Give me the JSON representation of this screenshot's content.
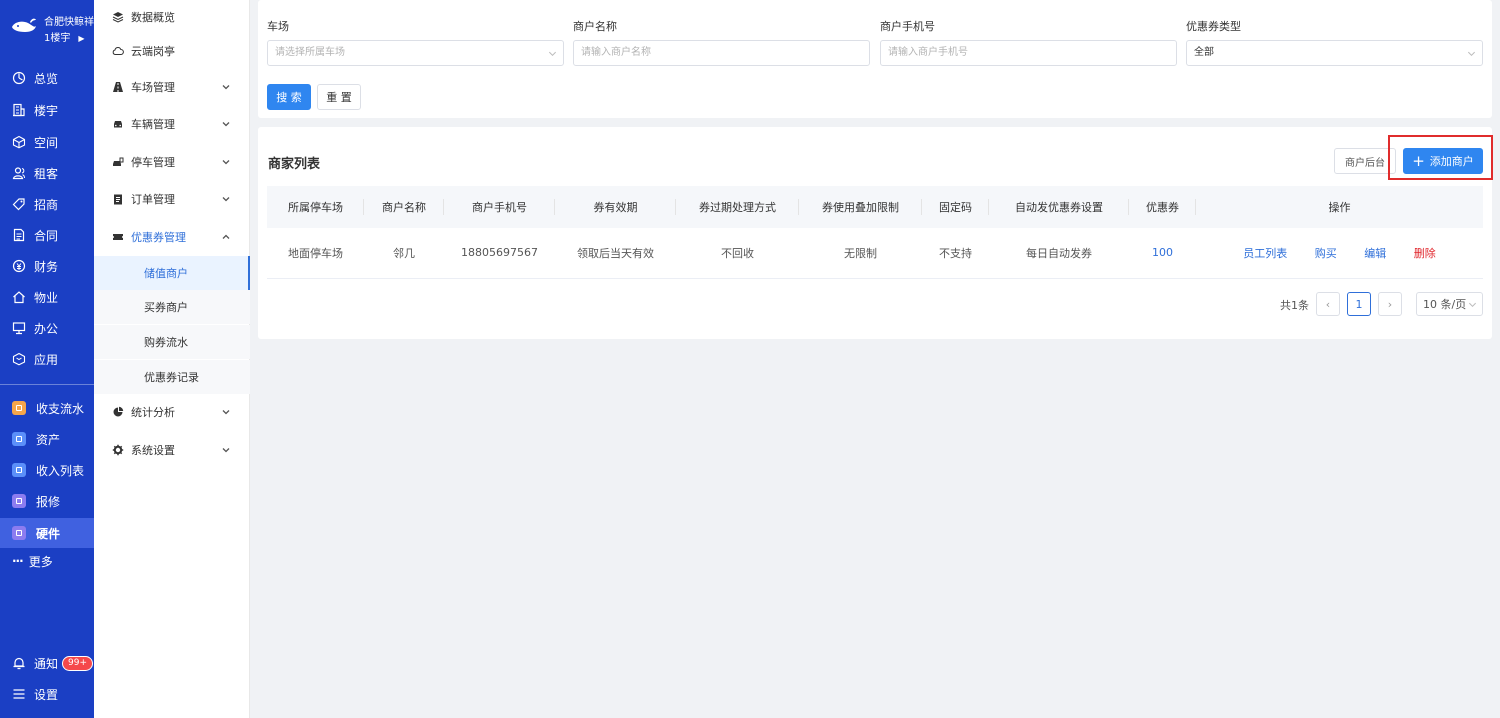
{
  "brand": {
    "line1": "合肥快鲸祥",
    "line2": "1楼宇"
  },
  "primary_nav": [
    {
      "label": "总览",
      "icon": "dashboard-icon"
    },
    {
      "label": "楼宇",
      "icon": "building-icon"
    },
    {
      "label": "空间",
      "icon": "cube-icon"
    },
    {
      "label": "租客",
      "icon": "users-icon"
    },
    {
      "label": "招商",
      "icon": "tag-icon"
    },
    {
      "label": "合同",
      "icon": "document-icon"
    },
    {
      "label": "财务",
      "icon": "money-icon"
    },
    {
      "label": "物业",
      "icon": "home-icon"
    },
    {
      "label": "办公",
      "icon": "monitor-icon"
    },
    {
      "label": "应用",
      "icon": "app-icon"
    }
  ],
  "primary_nav_apps": [
    {
      "label": "收支流水",
      "icon": "cashflow-icon",
      "color": "#f5a54a"
    },
    {
      "label": "资产",
      "icon": "asset-icon",
      "color": "#5b8ff9"
    },
    {
      "label": "收入列表",
      "icon": "income-list-icon",
      "color": "#5b8ff9"
    },
    {
      "label": "报修",
      "icon": "repair-icon",
      "color": "#8c7cf0"
    },
    {
      "label": "硬件",
      "icon": "hardware-icon",
      "color": "#8c7cf0"
    }
  ],
  "more_label": "更多",
  "notify": {
    "label": "通知",
    "badge": "99+"
  },
  "settings_label": "设置",
  "secondary_nav": {
    "items": [
      {
        "label": "数据概览",
        "icon": "layers-icon"
      },
      {
        "label": "云端岗亭",
        "icon": "cloud-icon"
      },
      {
        "label": "车场管理",
        "icon": "road-icon"
      },
      {
        "label": "车辆管理",
        "icon": "car-icon"
      },
      {
        "label": "停车管理",
        "icon": "parking-icon"
      },
      {
        "label": "订单管理",
        "icon": "order-icon"
      },
      {
        "label": "优惠券管理",
        "icon": "coupon-icon"
      },
      {
        "label": "统计分析",
        "icon": "pie-icon"
      },
      {
        "label": "系统设置",
        "icon": "gear-icon"
      }
    ],
    "sub_items": [
      "储值商户",
      "买券商户",
      "购券流水",
      "优惠券记录"
    ]
  },
  "filters": {
    "parking_lot": {
      "label": "车场",
      "placeholder": "请选择所属车场"
    },
    "merchant_name": {
      "label": "商户名称",
      "placeholder": "请输入商户名称"
    },
    "merchant_phone": {
      "label": "商户手机号",
      "placeholder": "请输入商户手机号"
    },
    "coupon_type": {
      "label": "优惠券类型",
      "value": "全部"
    },
    "search_label": "搜 索",
    "reset_label": "重 置"
  },
  "list": {
    "title": "商家列表",
    "merchant_backend_label": "商户后台",
    "add_merchant_label": "添加商户",
    "columns": [
      "所属停车场",
      "商户名称",
      "商户手机号",
      "券有效期",
      "券过期处理方式",
      "券使用叠加限制",
      "固定码",
      "自动发优惠券设置",
      "优惠券",
      "操作"
    ],
    "rows": [
      {
        "parking_lot": "地面停车场",
        "name": "邻几",
        "phone": "18805697567",
        "validity": "领取后当天有效",
        "expiry_handling": "不回收",
        "stacking_limit": "无限制",
        "fixed_code": "不支持",
        "auto_issue": "每日自动发券",
        "coupons": "100",
        "actions": {
          "staff": "员工列表",
          "buy": "购买",
          "edit": "编辑",
          "delete": "删除"
        }
      }
    ]
  },
  "pagination": {
    "total_text": "共1条",
    "current_page": "1",
    "page_size": "10 条/页"
  }
}
